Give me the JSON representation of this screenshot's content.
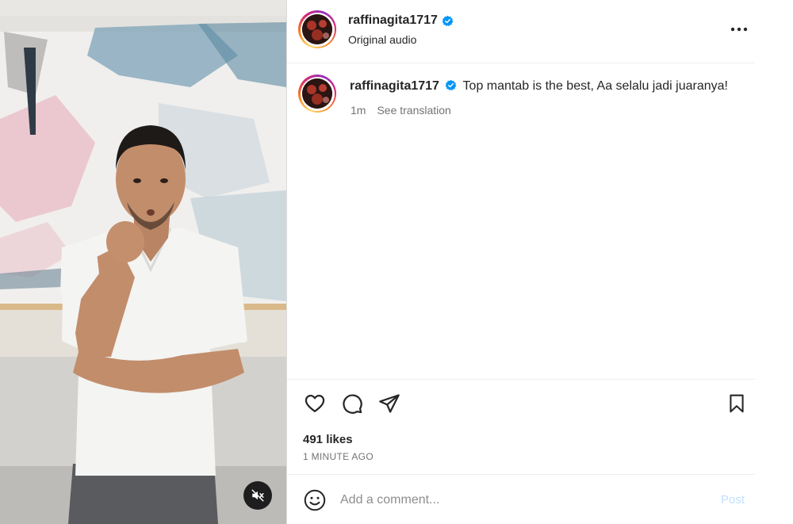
{
  "media": {
    "mute_icon": "speaker-muted-icon",
    "colors": {
      "background": "#d8d6d2",
      "shirt": "#f4f4f2",
      "skin": "#c28d6b",
      "hair": "#1e1a18",
      "trousers": "#5a5b5f"
    }
  },
  "header": {
    "username": "raffinagita1717",
    "subtitle": "Original audio",
    "verified_icon": "verified-badge-icon",
    "more_icon": "more-options-icon"
  },
  "caption": {
    "username": "raffinagita1717",
    "text": "Top mantab is the best, Aa selalu jadi juaranya!",
    "time": "1m",
    "translation_link": "See translation"
  },
  "actions": {
    "like_icon": "heart-icon",
    "comment_icon": "comment-icon",
    "share_icon": "share-icon",
    "save_icon": "bookmark-icon"
  },
  "stats": {
    "likes": "491 likes",
    "time_ago": "1 MINUTE AGO"
  },
  "comment": {
    "emoji_icon": "emoji-icon",
    "placeholder": "Add a comment...",
    "post_label": "Post"
  },
  "colors": {
    "verified": "#0095f6",
    "post_disabled": "#c0dffd",
    "secondary_text": "#737373",
    "divider": "#efefef"
  }
}
